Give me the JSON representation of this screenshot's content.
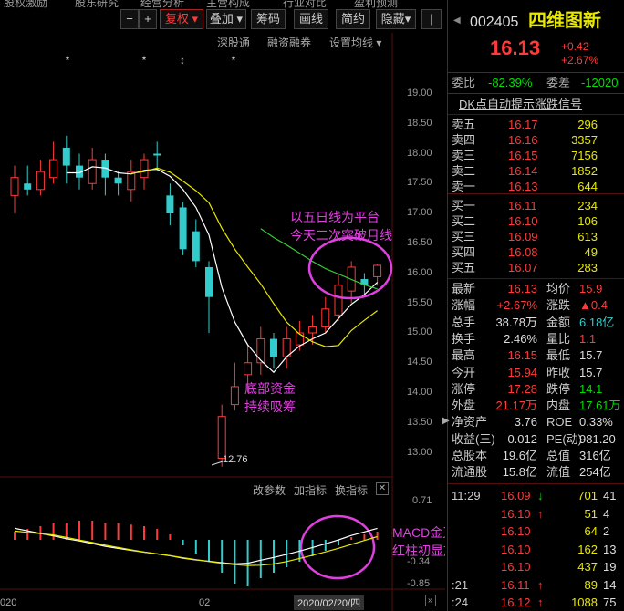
{
  "toptabs": [
    "股权激励",
    "股东研究",
    "经营分析",
    "主营构成",
    "行业对比",
    "盈利预测"
  ],
  "toolbar": {
    "btn_minus": "−",
    "btn_plus": "+",
    "btn_fuquan": "复权",
    "btn_diejia": "叠加",
    "btn_chouma": "筹码",
    "btn_huaxian": "画线",
    "btn_jianyue": "简约",
    "btn_yincang": "隐藏",
    "sub_shengu": "深股通",
    "sub_rongzi": "融资融券",
    "sub_junxian": "设置均线"
  },
  "price_axis": [
    "19.00",
    "18.50",
    "18.00",
    "17.50",
    "17.00",
    "16.50",
    "16.00",
    "15.50",
    "15.00",
    "14.50",
    "14.00",
    "13.50",
    "13.00"
  ],
  "low_marker": "12.76",
  "macd_toolbar": {
    "gaicanshu": "改参数",
    "jiazhibiao": "加指标",
    "huanzhibiao": "换指标",
    "close": "✕"
  },
  "macd_axis": [
    "0.71",
    "-0.34",
    "-0.85"
  ],
  "x_axis": {
    "left": "020",
    "mid": "02",
    "date": "2020/02/20/四"
  },
  "annotations": {
    "a1_l1": "以五日线为平台",
    "a1_l2": "今天二次突破月线",
    "a2_l1": "底部资金",
    "a2_l2": "持续吸筹",
    "a3_l1": "MACD金叉向上",
    "a3_l2": "红柱初显放量"
  },
  "chart_data": {
    "type": "candlestick",
    "ylim": [
      12.5,
      19.2
    ],
    "low": 12.76,
    "candles": [
      {
        "o": 17.3,
        "c": 17.6,
        "h": 17.8,
        "l": 17.0,
        "up": true
      },
      {
        "o": 17.5,
        "c": 17.4,
        "h": 17.8,
        "l": 17.3,
        "up": false
      },
      {
        "o": 17.4,
        "c": 17.7,
        "h": 17.9,
        "l": 17.3,
        "up": true
      },
      {
        "o": 17.6,
        "c": 17.9,
        "h": 18.2,
        "l": 17.5,
        "up": true
      },
      {
        "o": 18.1,
        "c": 17.8,
        "h": 18.3,
        "l": 17.5,
        "up": false
      },
      {
        "o": 17.8,
        "c": 17.6,
        "h": 18.0,
        "l": 17.4,
        "up": false
      },
      {
        "o": 17.5,
        "c": 17.9,
        "h": 18.1,
        "l": 17.4,
        "up": true
      },
      {
        "o": 17.9,
        "c": 17.6,
        "h": 18.0,
        "l": 17.3,
        "up": false
      },
      {
        "o": 17.6,
        "c": 17.5,
        "h": 17.7,
        "l": 17.3,
        "up": false
      },
      {
        "o": 17.4,
        "c": 17.7,
        "h": 17.9,
        "l": 17.2,
        "up": true
      },
      {
        "o": 17.6,
        "c": 17.9,
        "h": 18.0,
        "l": 17.4,
        "up": true
      },
      {
        "o": 18.0,
        "c": 18.0,
        "h": 18.2,
        "l": 17.7,
        "up": false
      },
      {
        "o": 17.3,
        "c": 17.0,
        "h": 17.5,
        "l": 16.8,
        "up": false
      },
      {
        "o": 17.1,
        "c": 16.4,
        "h": 17.2,
        "l": 16.3,
        "up": false
      },
      {
        "o": 16.7,
        "c": 16.2,
        "h": 16.9,
        "l": 16.1,
        "up": false
      },
      {
        "o": 16.1,
        "c": 15.6,
        "h": 16.2,
        "l": 15.0,
        "up": false
      },
      {
        "o": 12.9,
        "c": 13.6,
        "h": 13.8,
        "l": 12.76,
        "up": true
      },
      {
        "o": 13.8,
        "c": 14.1,
        "h": 14.5,
        "l": 13.7,
        "up": true
      },
      {
        "o": 14.3,
        "c": 14.5,
        "h": 14.8,
        "l": 14.0,
        "up": true
      },
      {
        "o": 14.5,
        "c": 14.9,
        "h": 15.1,
        "l": 14.3,
        "up": true
      },
      {
        "o": 14.9,
        "c": 14.6,
        "h": 15.0,
        "l": 14.4,
        "up": false
      },
      {
        "o": 14.6,
        "c": 14.9,
        "h": 15.1,
        "l": 14.4,
        "up": true
      },
      {
        "o": 14.8,
        "c": 15.0,
        "h": 15.2,
        "l": 14.7,
        "up": true
      },
      {
        "o": 15.0,
        "c": 15.1,
        "h": 15.3,
        "l": 14.8,
        "up": true
      },
      {
        "o": 15.1,
        "c": 15.4,
        "h": 15.6,
        "l": 15.0,
        "up": true
      },
      {
        "o": 15.3,
        "c": 15.8,
        "h": 16.0,
        "l": 15.2,
        "up": true
      },
      {
        "o": 15.7,
        "c": 16.1,
        "h": 16.2,
        "l": 15.5,
        "up": true
      },
      {
        "o": 15.9,
        "c": 15.8,
        "h": 16.0,
        "l": 15.6,
        "up": false
      },
      {
        "o": 15.94,
        "c": 16.13,
        "h": 16.15,
        "l": 15.79,
        "up": true
      }
    ],
    "macd_bars": [
      0.15,
      0.2,
      0.25,
      0.3,
      0.3,
      0.35,
      0.35,
      0.3,
      0.3,
      0.28,
      0.25,
      0.2,
      0.1,
      -0.1,
      -0.25,
      -0.4,
      -0.6,
      -0.8,
      -0.85,
      -0.7,
      -0.6,
      -0.5,
      -0.4,
      -0.3,
      -0.2,
      -0.1,
      0.05,
      0.1,
      0.15
    ]
  },
  "panel": {
    "code": "002405",
    "name": "四维图新",
    "price": "16.13",
    "change": "+0.42",
    "change_pct": "+2.67%",
    "weibi_label": "委比",
    "weibi": "-82.39%",
    "weicha_label": "委差",
    "weicha": "-12020",
    "dk": "DK点自动提示涨跌信号",
    "sells": [
      {
        "label": "卖五",
        "price": "16.17",
        "vol": "296"
      },
      {
        "label": "卖四",
        "price": "16.16",
        "vol": "3357"
      },
      {
        "label": "卖三",
        "price": "16.15",
        "vol": "7156"
      },
      {
        "label": "卖二",
        "price": "16.14",
        "vol": "1852"
      },
      {
        "label": "卖一",
        "price": "16.13",
        "vol": "644"
      }
    ],
    "buys": [
      {
        "label": "买一",
        "price": "16.11",
        "vol": "234"
      },
      {
        "label": "买二",
        "price": "16.10",
        "vol": "106"
      },
      {
        "label": "买三",
        "price": "16.09",
        "vol": "613"
      },
      {
        "label": "买四",
        "price": "16.08",
        "vol": "49"
      },
      {
        "label": "买五",
        "price": "16.07",
        "vol": "283"
      }
    ],
    "stats": [
      {
        "l1": "最新",
        "v1": "16.13",
        "c1": "red",
        "l2": "均价",
        "v2": "15.9",
        "c2": "red"
      },
      {
        "l1": "涨幅",
        "v1": "+2.67%",
        "c1": "red",
        "l2": "涨跌",
        "v2": "▲0.4",
        "c2": "red"
      },
      {
        "l1": "总手",
        "v1": "38.78万",
        "c1": "white",
        "l2": "金额",
        "v2": "6.18亿",
        "c2": "cyan"
      },
      {
        "l1": "换手",
        "v1": "2.46%",
        "c1": "white",
        "l2": "量比",
        "v2": "1.1",
        "c2": "red"
      },
      {
        "l1": "最高",
        "v1": "16.15",
        "c1": "red",
        "l2": "最低",
        "v2": "15.7",
        "c2": "white"
      },
      {
        "l1": "今开",
        "v1": "15.94",
        "c1": "red",
        "l2": "昨收",
        "v2": "15.7",
        "c2": "white"
      },
      {
        "l1": "涨停",
        "v1": "17.28",
        "c1": "red",
        "l2": "跌停",
        "v2": "14.1",
        "c2": "green"
      },
      {
        "l1": "外盘",
        "v1": "21.17万",
        "c1": "red",
        "l2": "内盘",
        "v2": "17.61万",
        "c2": "green"
      },
      {
        "l1": "净资产",
        "v1": "3.76",
        "c1": "white",
        "l2": "ROE",
        "v2": "0.33%",
        "c2": "white"
      },
      {
        "l1": "收益(三)",
        "v1": "0.012",
        "c1": "white",
        "l2": "PE(动)",
        "v2": "981.20",
        "c2": "white"
      },
      {
        "l1": "总股本",
        "v1": "19.6亿",
        "c1": "white",
        "l2": "总值",
        "v2": "316亿",
        "c2": "white"
      },
      {
        "l1": "流通股",
        "v1": "15.8亿",
        "c1": "white",
        "l2": "流值",
        "v2": "254亿",
        "c2": "white"
      }
    ],
    "ticks": [
      {
        "time": "11:29",
        "price": "16.09",
        "arrow": "↓",
        "vol": "701",
        "n": "41",
        "pc": "red",
        "ac": "green"
      },
      {
        "time": "",
        "price": "16.10",
        "arrow": "↑",
        "vol": "51",
        "n": "4",
        "pc": "red",
        "ac": "red"
      },
      {
        "time": "",
        "price": "16.10",
        "arrow": "",
        "vol": "64",
        "n": "2",
        "pc": "red",
        "ac": "red"
      },
      {
        "time": "",
        "price": "16.10",
        "arrow": "",
        "vol": "162",
        "n": "13",
        "pc": "red",
        "ac": "red"
      },
      {
        "time": "",
        "price": "16.10",
        "arrow": "",
        "vol": "437",
        "n": "19",
        "pc": "red",
        "ac": "red"
      },
      {
        "time": ":21",
        "price": "16.11",
        "arrow": "↑",
        "vol": "89",
        "n": "14",
        "pc": "red",
        "ac": "red"
      },
      {
        "time": ":24",
        "price": "16.12",
        "arrow": "↑",
        "vol": "1088",
        "n": "75",
        "pc": "red",
        "ac": "red"
      }
    ]
  }
}
